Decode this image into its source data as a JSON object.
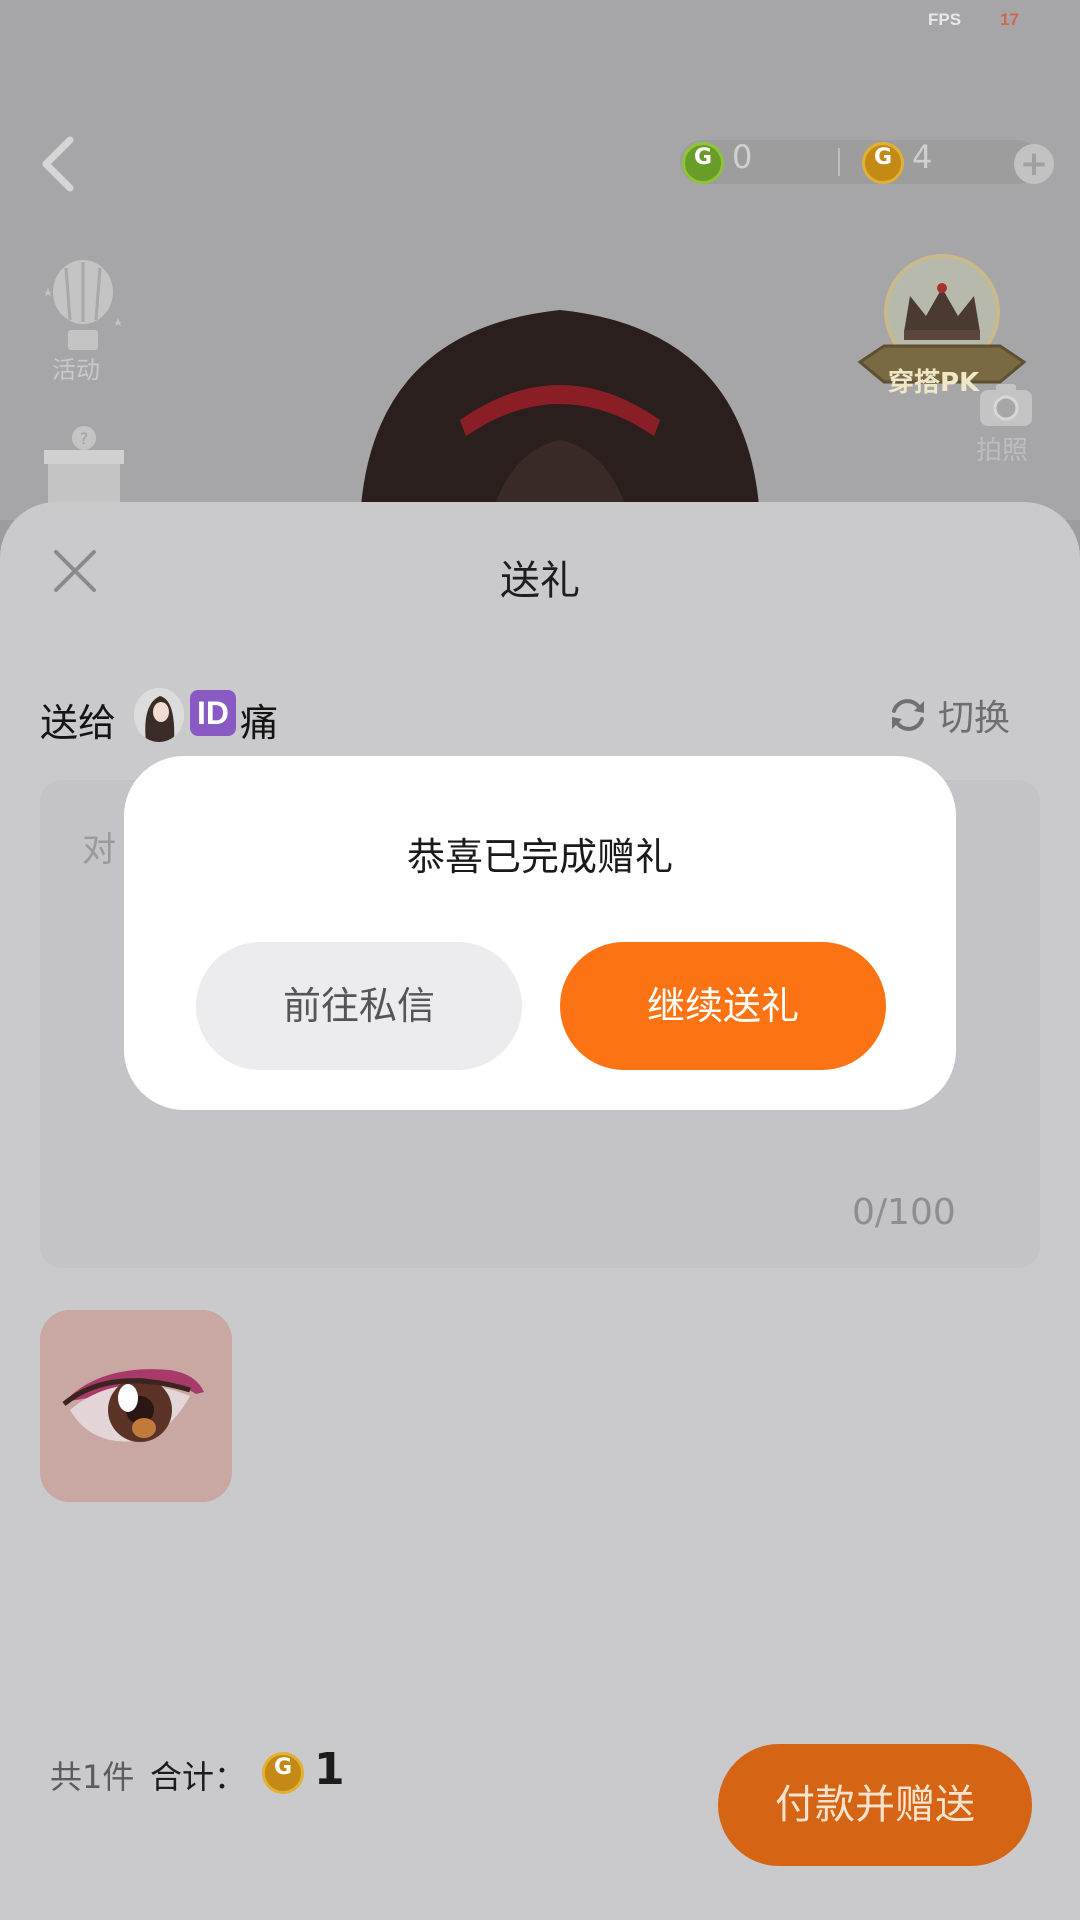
{
  "status": {
    "fps_label": "FPS",
    "fps_value": "17"
  },
  "header": {
    "currency": [
      {
        "icon": "green-coin-icon",
        "symbol": "G",
        "value": "0",
        "color": "#6a9c2a"
      },
      {
        "icon": "gold-coin-icon",
        "symbol": "G",
        "value": "4",
        "color": "#c48a15"
      }
    ]
  },
  "side_menu": {
    "activity_label": "活动"
  },
  "right_menu": {
    "pk_label": "穿搭PK",
    "camera_label": "拍照"
  },
  "sheet": {
    "title": "送礼",
    "send_to_label": "送给",
    "recipient_badge": "ID",
    "recipient_name": "痛",
    "switch_label": "切换",
    "message_placeholder": "对",
    "message_counter": "0/100",
    "footer": {
      "count_label": "共1件",
      "total_label": "合计：",
      "coin_symbol": "G",
      "total_value": "1",
      "pay_button": "付款并赠送"
    }
  },
  "modal": {
    "title": "恭喜已完成赠礼",
    "secondary_button": "前往私信",
    "primary_button": "继续送礼"
  },
  "colors": {
    "accent": "#fc7313",
    "pay_button": "#d56514",
    "id_badge": "#8a5ac4"
  }
}
